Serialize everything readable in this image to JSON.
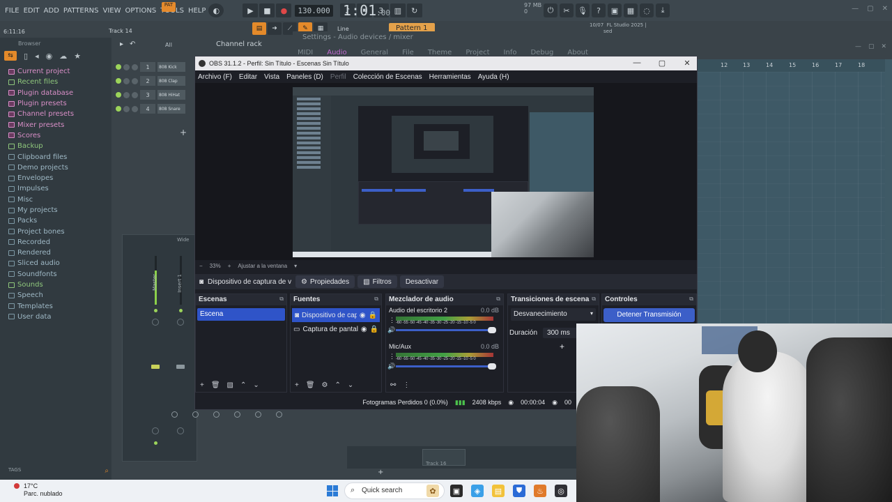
{
  "fl": {
    "menu": [
      "FILE",
      "EDIT",
      "ADD",
      "PATTERNS",
      "VIEW",
      "OPTIONS",
      "TOOLS",
      "HELP"
    ],
    "pat_label": "PAT",
    "bpm": "130.000",
    "time_main": "1:01",
    "time_sub": ":00",
    "mem_top": "97 MB",
    "mem_bot": "0",
    "clock": "6:11:16",
    "track_hint": "Track 14",
    "pattern": "Pattern 1",
    "snap": "Line",
    "news": "10/07  FL Studio 2025 |\n         sed",
    "settings_title": "Settings - Audio devices / mixer",
    "settings_tabs": [
      "MIDI",
      "Audio",
      "General",
      "File",
      "Theme",
      "Project",
      "Info",
      "Debug",
      "About"
    ],
    "browser_head": "Browser",
    "browser_items": [
      {
        "label": "Current project",
        "style": "pink"
      },
      {
        "label": "Recent files",
        "style": "green"
      },
      {
        "label": "Plugin database",
        "style": "pink"
      },
      {
        "label": "Plugin presets",
        "style": "pink"
      },
      {
        "label": "Channel presets",
        "style": "pink"
      },
      {
        "label": "Mixer presets",
        "style": "pink"
      },
      {
        "label": "Scores",
        "style": "pink"
      },
      {
        "label": "Backup",
        "style": "green"
      },
      {
        "label": "Clipboard files",
        "style": "blue"
      },
      {
        "label": "Demo projects",
        "style": "blue"
      },
      {
        "label": "Envelopes",
        "style": "blue"
      },
      {
        "label": "Impulses",
        "style": "blue"
      },
      {
        "label": "Misc",
        "style": "blue"
      },
      {
        "label": "My projects",
        "style": "blue"
      },
      {
        "label": "Packs",
        "style": "blue"
      },
      {
        "label": "Project bones",
        "style": "blue"
      },
      {
        "label": "Recorded",
        "style": "blue"
      },
      {
        "label": "Rendered",
        "style": "blue"
      },
      {
        "label": "Sliced audio",
        "style": "blue"
      },
      {
        "label": "Soundfonts",
        "style": "blue"
      },
      {
        "label": "Sounds",
        "style": "green"
      },
      {
        "label": "Speech",
        "style": "blue"
      },
      {
        "label": "Templates",
        "style": "blue"
      },
      {
        "label": "User data",
        "style": "blue"
      }
    ],
    "browser_tags": "TAGS",
    "rack_filter": "All",
    "rack_title": "Channel rack",
    "rack_rows": [
      {
        "num": "1",
        "name": "808 Kick"
      },
      {
        "num": "2",
        "name": "808 Clap"
      },
      {
        "num": "3",
        "name": "808 HiHat"
      },
      {
        "num": "4",
        "name": "808 Snare"
      }
    ],
    "mixer_head": "Wide",
    "mixer_master": "Master",
    "mixer_insert": "Insert 1",
    "playlist_ruler": [
      "12",
      "13",
      "14",
      "15",
      "16",
      "17",
      "18"
    ],
    "playlist_track": "Track 16"
  },
  "obs": {
    "title": "OBS 31.1.2 - Perfil: Sin Título - Escenas Sin Título",
    "menu": [
      "Archivo (F)",
      "Editar",
      "Vista",
      "Paneles (D)",
      "Perfil",
      "Colección de Escenas",
      "Herramientas",
      "Ayuda (H)"
    ],
    "zoom": "33%",
    "fit": "Ajustar a la ventana",
    "selected_source": "Dispositivo de captura de v",
    "btn_properties": "Propiedades",
    "btn_filters": "Filtros",
    "btn_deactivate": "Desactivar",
    "scenes_title": "Escenas",
    "scenes": [
      "Escena"
    ],
    "sources_title": "Fuentes",
    "sources": [
      "Dispositivo de cap",
      "Captura de pantal"
    ],
    "mixer_title": "Mezclador de audio",
    "mixer_channels": [
      {
        "name": "Audio del escritorio 2",
        "db": "0.0 dB"
      },
      {
        "name": "Mic/Aux",
        "db": "0.0 dB"
      }
    ],
    "mixer_ticks": "-60 -55 -50 -45 -40 -35 -30 -25 -20 -15 -10 -5 0",
    "transitions_title": "Transiciones de escena",
    "transition": "Desvanecimiento",
    "duration_label": "Duración",
    "duration_value": "300 ms",
    "controls_title": "Controles",
    "stop_stream": "Detener Transmisión",
    "status_dropped": "Fotogramas Perdidos 0 (0.0%)",
    "status_kbps": "2408 kbps",
    "status_time": "00:00:04",
    "status_more": "00"
  },
  "taskbar": {
    "temp": "17°C",
    "weather": "Parc. nublado",
    "search": "Quick search"
  }
}
